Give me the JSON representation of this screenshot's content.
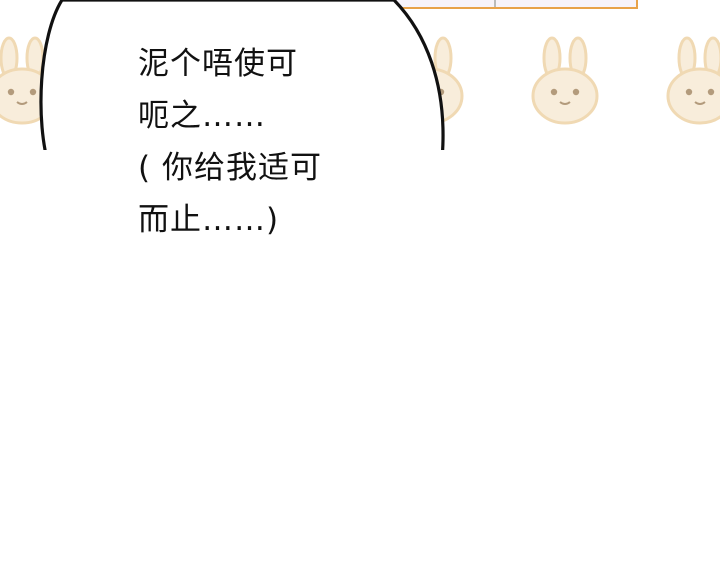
{
  "speech_bubble": {
    "lines": [
      "泥个唔使可",
      "呃之……",
      "( 你给我适可",
      "而止……)"
    ]
  },
  "colors": {
    "background": "#ffffff",
    "bunny_fill": "#f8eddb",
    "bunny_outline": "#f0d9b3",
    "frame_border": "#e8a24a",
    "bubble_stroke": "#111111"
  }
}
